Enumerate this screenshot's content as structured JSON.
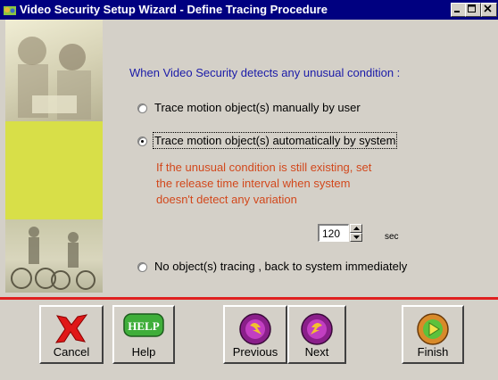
{
  "window": {
    "title": "Video Security Setup Wizard - Define Tracing Procedure"
  },
  "content": {
    "heading": "When Video Security detects any unusual condition :",
    "options": [
      {
        "label": "Trace motion object(s) manually by user",
        "selected": false
      },
      {
        "label": "Trace motion object(s) automatically by system",
        "selected": true
      },
      {
        "label": "No object(s) tracing , back to system immediately",
        "selected": false
      }
    ],
    "note_lines": [
      "If the unusual condition is still existing, set",
      "the release time interval when system",
      "doesn't detect any variation"
    ],
    "interval": {
      "value": "120",
      "unit": "sec"
    }
  },
  "buttons": {
    "cancel": "Cancel",
    "help": "Help",
    "help_icon_text": "HELP",
    "previous": "Previous",
    "next": "Next",
    "finish": "Finish"
  },
  "colors": {
    "title_bar": "#000080",
    "heading_text": "#1a1aa8",
    "note_text": "#d2481c",
    "divider": "#e02020",
    "face": "#d4d0c8"
  },
  "icons": {
    "app": "app-icon",
    "minimize": "minimize-icon",
    "maximize": "maximize-icon",
    "close": "close-icon",
    "cancel": "cancel-x-icon",
    "help": "help-icon",
    "previous": "previous-icon",
    "next": "next-icon",
    "finish": "finish-icon"
  }
}
